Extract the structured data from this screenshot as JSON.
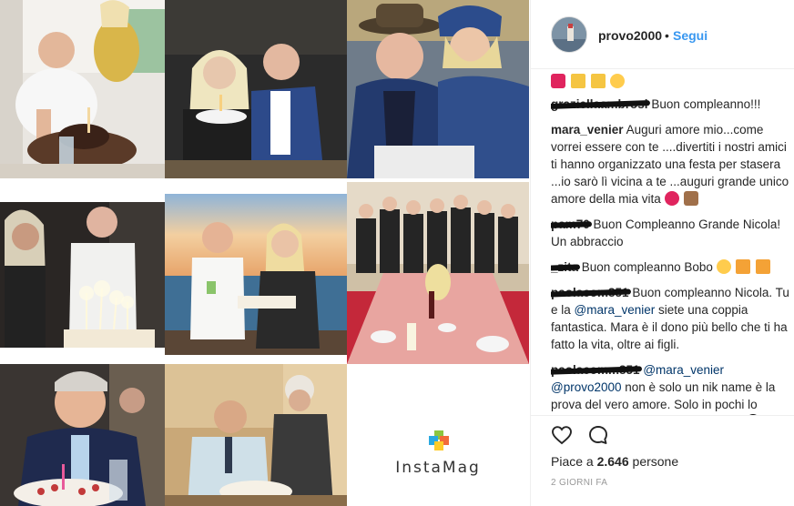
{
  "post": {
    "username": "provo2000",
    "separator": "•",
    "follow_label": "Segui",
    "likes_prefix": "Piace a ",
    "likes_count": "2.646",
    "likes_suffix": " persone",
    "timestamp": "2 GIORNI FA"
  },
  "comments": [
    {
      "user": "graziellaambrosi",
      "redacted": true,
      "parts": [
        {
          "t": "Buon compleanno!!!"
        }
      ]
    },
    {
      "user": "mara_venier",
      "redacted": false,
      "parts": [
        {
          "t": "Auguri amore mio...come vorrei essere con te ....divertiti i nostri amici ti hanno organizzato una festa per stasera ...io sarò lì vicina a te ...auguri grande unico amore della mia vita"
        }
      ],
      "emojis": [
        "heart",
        "cake"
      ]
    },
    {
      "user": "pam70",
      "redacted": true,
      "parts": [
        {
          "t": "Buon Compleanno Grande Nicola! Un abbraccio"
        }
      ]
    },
    {
      "user": "_zita",
      "redacted": true,
      "parts": [
        {
          "t": "Buon compleanno Bobo"
        }
      ],
      "emojis": [
        "kiss",
        "party",
        "party"
      ]
    },
    {
      "user": "paolacom851",
      "redacted": true,
      "parts": [
        {
          "t": "Buon compleanno Nicola. Tu e la "
        },
        {
          "t": "@mara_venier",
          "mention": true
        },
        {
          "t": " siete una coppia fantastica. Mara è il dono più bello che ti ha fatto la vita, oltre ai figli."
        }
      ]
    },
    {
      "user": "paolacomm851",
      "redacted": true,
      "parts": [
        {
          "t": "@mara_venier",
          "mention": true
        },
        {
          "t": " "
        },
        {
          "t": "@provo2000",
          "mention": true
        },
        {
          "t": " non è solo un nik name è la prova del vero amore. Solo in pochi lo capiscono. Io lo capito fin da subito"
        }
      ],
      "emojis": [
        "blackheart"
      ]
    }
  ],
  "instamag": {
    "label": "InstaMag"
  },
  "icons": {
    "like": "heart-icon",
    "comment": "comment-bubble-icon"
  },
  "colors": {
    "link": "#3897f0",
    "text": "#262626",
    "muted": "#999999",
    "mention": "#003569"
  }
}
